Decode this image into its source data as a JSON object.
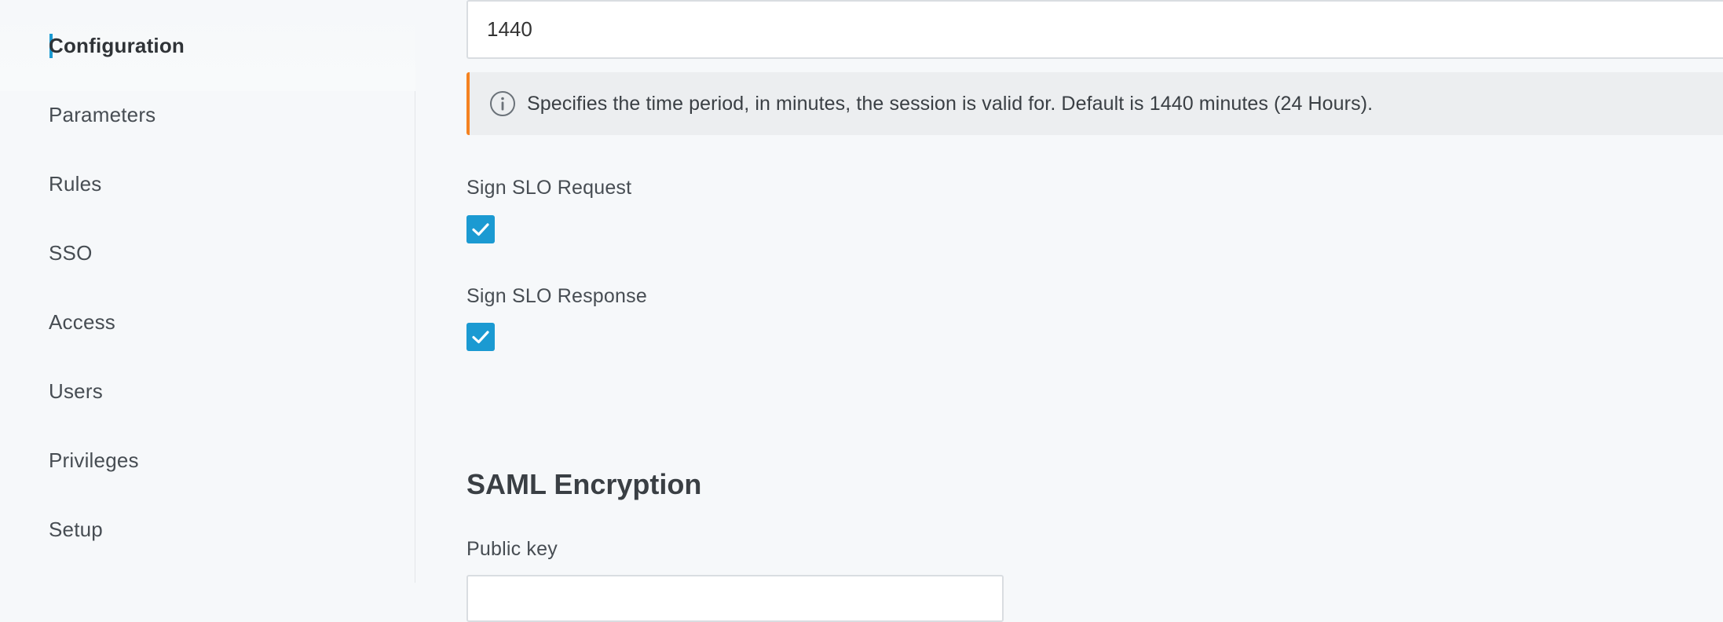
{
  "sidebar": {
    "items": [
      {
        "label": "Configuration",
        "active": true
      },
      {
        "label": "Parameters"
      },
      {
        "label": "Rules"
      },
      {
        "label": "SSO"
      },
      {
        "label": "Access"
      },
      {
        "label": "Users"
      },
      {
        "label": "Privileges"
      },
      {
        "label": "Setup"
      }
    ],
    "accent_color": "#1b9ad2"
  },
  "main": {
    "session_timeout_value": "1440",
    "info": {
      "icon": "info-circle-icon",
      "text": "Specifies the time period, in minutes, the session is valid for. Default is 1440 minutes (24 Hours).",
      "accent_color": "#f58220"
    },
    "sign_slo_request": {
      "label": "Sign SLO Request",
      "checked": true
    },
    "sign_slo_response": {
      "label": "Sign SLO Response",
      "checked": true
    },
    "saml_encryption": {
      "title": "SAML Encryption",
      "public_key_label": "Public key",
      "public_key_value": ""
    }
  }
}
